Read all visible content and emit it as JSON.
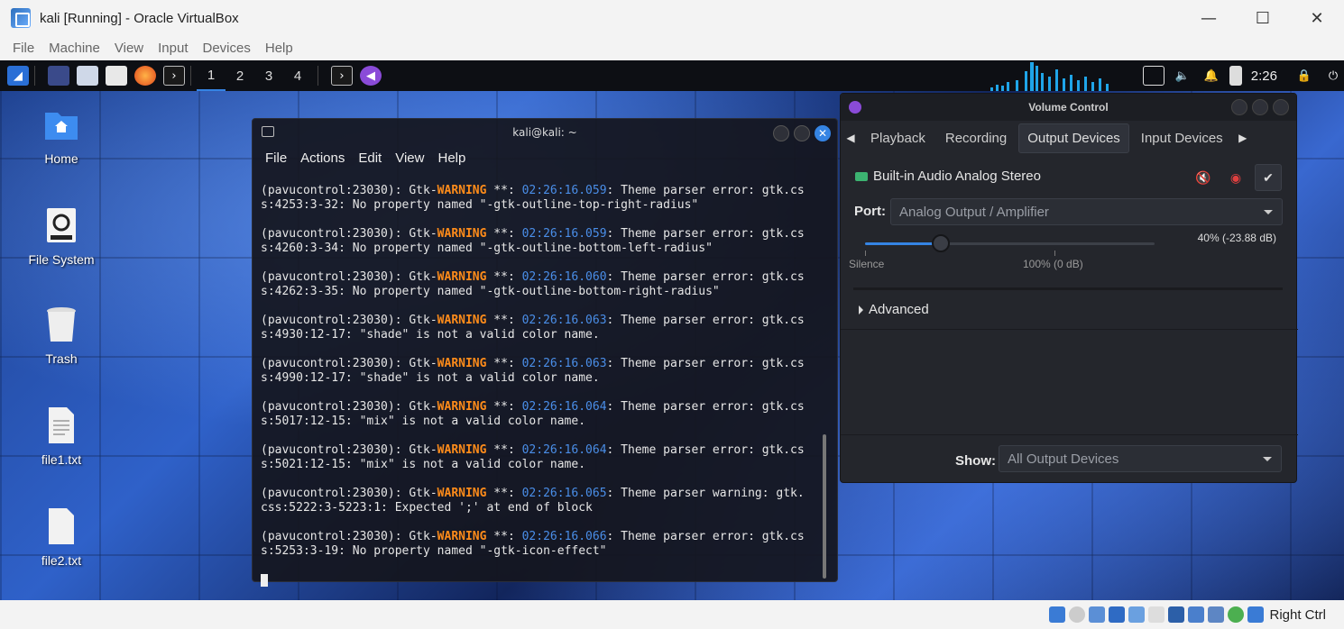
{
  "host": {
    "title": "kali [Running] - Oracle VirtualBox",
    "menu": [
      "File",
      "Machine",
      "View",
      "Input",
      "Devices",
      "Help"
    ],
    "window_controls": {
      "minimize": "—",
      "maximize": "☐",
      "close": "✕"
    },
    "host_key": "Right Ctrl"
  },
  "panel": {
    "workspaces": [
      "1",
      "2",
      "3",
      "4"
    ],
    "active_workspace": "1",
    "clock": "2:26"
  },
  "desktop": {
    "icons": [
      {
        "label": "Home"
      },
      {
        "label": "File System"
      },
      {
        "label": "Trash"
      },
      {
        "label": "file1.txt"
      },
      {
        "label": "file2.txt"
      }
    ]
  },
  "terminal": {
    "title": "kali@kali: ~",
    "menu": [
      "File",
      "Actions",
      "Edit",
      "View",
      "Help"
    ],
    "entries": [
      {
        "prefix": "(pavucontrol:23030): Gtk-",
        "level": "WARNING",
        "mid": " **: ",
        "time": "02:26:16.059",
        "msg": ": Theme parser error: gtk.cs",
        "line2": "s:4253:3-32: No property named \"-gtk-outline-top-right-radius\""
      },
      {
        "prefix": "(pavucontrol:23030): Gtk-",
        "level": "WARNING",
        "mid": " **: ",
        "time": "02:26:16.059",
        "msg": ": Theme parser error: gtk.cs",
        "line2": "s:4260:3-34: No property named \"-gtk-outline-bottom-left-radius\""
      },
      {
        "prefix": "(pavucontrol:23030): Gtk-",
        "level": "WARNING",
        "mid": " **: ",
        "time": "02:26:16.060",
        "msg": ": Theme parser error: gtk.cs",
        "line2": "s:4262:3-35: No property named \"-gtk-outline-bottom-right-radius\""
      },
      {
        "prefix": "(pavucontrol:23030): Gtk-",
        "level": "WARNING",
        "mid": " **: ",
        "time": "02:26:16.063",
        "msg": ": Theme parser error: gtk.cs",
        "line2": "s:4930:12-17: \"shade\" is not a valid color name."
      },
      {
        "prefix": "(pavucontrol:23030): Gtk-",
        "level": "WARNING",
        "mid": " **: ",
        "time": "02:26:16.063",
        "msg": ": Theme parser error: gtk.cs",
        "line2": "s:4990:12-17: \"shade\" is not a valid color name."
      },
      {
        "prefix": "(pavucontrol:23030): Gtk-",
        "level": "WARNING",
        "mid": " **: ",
        "time": "02:26:16.064",
        "msg": ": Theme parser error: gtk.cs",
        "line2": "s:5017:12-15: \"mix\" is not a valid color name."
      },
      {
        "prefix": "(pavucontrol:23030): Gtk-",
        "level": "WARNING",
        "mid": " **: ",
        "time": "02:26:16.064",
        "msg": ": Theme parser error: gtk.cs",
        "line2": "s:5021:12-15: \"mix\" is not a valid color name."
      },
      {
        "prefix": "(pavucontrol:23030): Gtk-",
        "level": "WARNING",
        "mid": " **: ",
        "time": "02:26:16.065",
        "msg": ": Theme parser warning: gtk.",
        "line2": "css:5222:3-5223:1: Expected ';' at end of block"
      },
      {
        "prefix": "(pavucontrol:23030): Gtk-",
        "level": "WARNING",
        "mid": " **: ",
        "time": "02:26:16.066",
        "msg": ": Theme parser error: gtk.cs",
        "line2": "s:5253:3-19: No property named \"-gtk-icon-effect\""
      }
    ],
    "colors": {
      "warning": "#ff8c1a",
      "timestamp": "#4a8ee8"
    }
  },
  "volume": {
    "title": "Volume Control",
    "tabs": [
      "Playback",
      "Recording",
      "Output Devices",
      "Input Devices"
    ],
    "selected_tab": "Output Devices",
    "device_name": "Built-in Audio Analog Stereo",
    "port_label": "Port:",
    "port_value": "Analog Output / Amplifier",
    "volume_percent": 40,
    "volume_text": "40% (-23.88 dB)",
    "tick_silence": "Silence",
    "tick_100": "100% (0 dB)",
    "advanced_label": "Advanced",
    "show_label": "Show:",
    "show_value": "All Output Devices"
  }
}
